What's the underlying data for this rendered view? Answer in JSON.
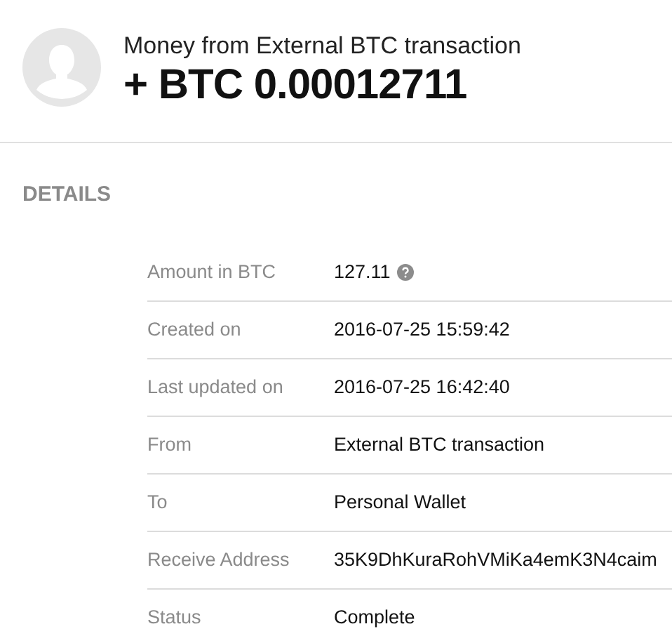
{
  "header": {
    "title": "Money from External BTC transaction",
    "amount": "+ BTC 0.00012711"
  },
  "section_title": "DETAILS",
  "details": [
    {
      "label": "Amount in BTC",
      "value": "127.11",
      "kind": "help"
    },
    {
      "label": "Created on",
      "value": "2016-07-25 15:59:42",
      "kind": "plain"
    },
    {
      "label": "Last updated on",
      "value": "2016-07-25 16:42:40",
      "kind": "plain"
    },
    {
      "label": "From",
      "value": "External BTC transaction",
      "kind": "plain"
    },
    {
      "label": "To",
      "value": "Personal Wallet",
      "kind": "plain"
    },
    {
      "label": "Receive Address",
      "value": "35K9DhKuraRohVMiKa4emK3N4caim",
      "kind": "plain"
    },
    {
      "label": "Status",
      "value": "Complete",
      "kind": "plain"
    }
  ]
}
